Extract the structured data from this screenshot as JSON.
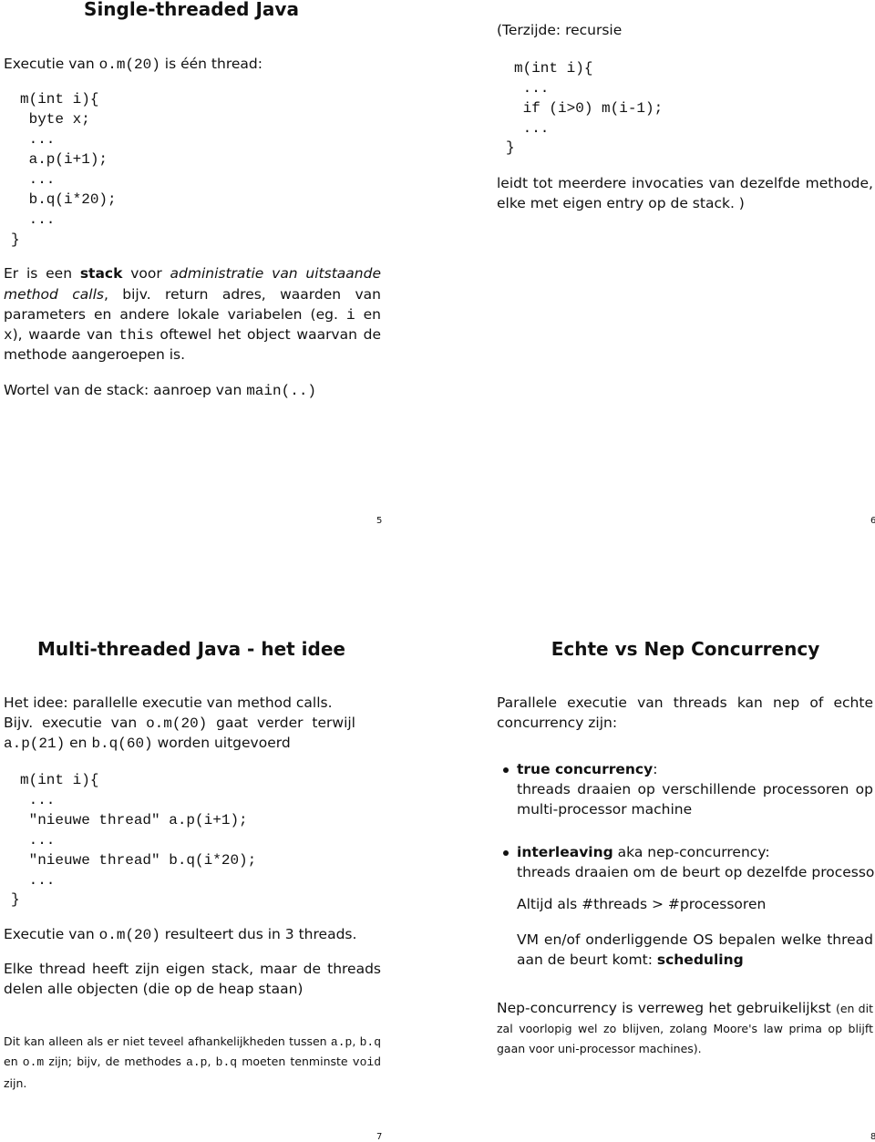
{
  "slides": [
    {
      "title": "Single-threaded Java",
      "page": "5",
      "lines": [
        [
          [
            "r",
            "Executie van "
          ],
          [
            "m",
            "o.m(20)"
          ],
          [
            "r",
            " is één thread:"
          ]
        ],
        [
          [
            "m",
            "m(int i){"
          ]
        ],
        [
          [
            "m",
            " byte x;"
          ]
        ],
        [
          [
            "m",
            " ..."
          ]
        ],
        [
          [
            "m",
            " a.p(i+1);"
          ]
        ],
        [
          [
            "m",
            " ..."
          ]
        ],
        [
          [
            "m",
            " b.q(i*20);"
          ]
        ],
        [
          [
            "m",
            " ..."
          ]
        ],
        [
          [
            "m",
            "}"
          ]
        ],
        [
          [
            "r",
            "Er is een "
          ],
          [
            "b",
            "stack"
          ],
          [
            "r",
            " voor "
          ],
          [
            "i",
            "administratie van uitstaande"
          ]
        ],
        [
          [
            "i",
            "method calls"
          ],
          [
            "r",
            ", bijv. return adres, waarden van"
          ]
        ],
        [
          [
            "r",
            "parameters en andere lokale variabelen (eg. "
          ],
          [
            "m",
            "i"
          ],
          [
            "r",
            " en"
          ]
        ],
        [
          [
            "m",
            "x"
          ],
          [
            "r",
            "), waarde van "
          ],
          [
            "m",
            "this"
          ],
          [
            "r",
            " oftewel het object waarvan de"
          ]
        ],
        [
          [
            "r",
            "methode aangeroepen is."
          ]
        ],
        [
          [
            "r",
            "Wortel van de stack: aanroep van "
          ],
          [
            "m",
            "main(..)"
          ]
        ]
      ]
    },
    {
      "page": "6",
      "lines": [
        [
          [
            "r",
            "(Terzijde: recursie"
          ]
        ],
        [
          [
            "m",
            "m(int i){"
          ]
        ],
        [
          [
            "m",
            " ..."
          ]
        ],
        [
          [
            "m",
            " if (i>0) m(i-1);"
          ]
        ],
        [
          [
            "m",
            " ..."
          ]
        ],
        [
          [
            "m",
            "}"
          ]
        ],
        [
          [
            "r",
            "leidt tot meerdere invocaties van dezelfde methode,"
          ]
        ],
        [
          [
            "r",
            "elke met eigen entry op de stack. )"
          ]
        ]
      ]
    },
    {
      "title": "Multi-threaded Java - het idee",
      "page": "7",
      "lines": [
        [
          [
            "r",
            "Het idee: parallelle executie van method calls."
          ]
        ],
        [
          [
            "r",
            "Bijv. executie van "
          ],
          [
            "m",
            "o.m(20)"
          ],
          [
            "r",
            " gaat verder terwijl"
          ]
        ],
        [
          [
            "m",
            "a.p(21)"
          ],
          [
            "r",
            " en "
          ],
          [
            "m",
            "b.q(60)"
          ],
          [
            "r",
            " worden uitgevoerd"
          ]
        ],
        [
          [
            "m",
            "m(int i){"
          ]
        ],
        [
          [
            "m",
            " ..."
          ]
        ],
        [
          [
            "m",
            " \"nieuwe thread\" a.p(i+1);"
          ]
        ],
        [
          [
            "m",
            " ..."
          ]
        ],
        [
          [
            "m",
            " \"nieuwe thread\" b.q(i*20);"
          ]
        ],
        [
          [
            "m",
            " ..."
          ]
        ],
        [
          [
            "m",
            "}"
          ]
        ],
        [
          [
            "r",
            "Executie van "
          ],
          [
            "m",
            "o.m(20)"
          ],
          [
            "r",
            " resulteert dus in 3 threads."
          ]
        ],
        [
          [
            "r",
            "Elke thread heeft zijn eigen stack, maar de threads"
          ]
        ],
        [
          [
            "r",
            "delen alle objecten (die op de heap staan)"
          ]
        ],
        [
          [
            "s",
            "Dit kan alleen als er niet teveel afhankelijkheden tussen "
          ],
          [
            "ms",
            "a.p"
          ],
          [
            "s",
            ", "
          ],
          [
            "ms",
            "b.q"
          ]
        ],
        [
          [
            "s",
            "en "
          ],
          [
            "ms",
            "o.m"
          ],
          [
            "s",
            " zijn; bijv, de methodes "
          ],
          [
            "ms",
            "a.p"
          ],
          [
            "s",
            ", "
          ],
          [
            "ms",
            "b.q"
          ],
          [
            "s",
            " moeten tenminste "
          ],
          [
            "ms",
            "void"
          ]
        ],
        [
          [
            "s",
            "zijn."
          ]
        ]
      ]
    },
    {
      "title": "Echte vs Nep Concurrency",
      "page": "8",
      "lines": [
        [
          [
            "r",
            "Parallele executie van threads kan nep of echte"
          ]
        ],
        [
          [
            "r",
            "concurrency zijn:"
          ]
        ],
        [
          [
            "b",
            "true concurrency"
          ],
          [
            "r",
            ":"
          ]
        ],
        [
          [
            "r",
            "threads draaien op verschillende processoren op"
          ]
        ],
        [
          [
            "r",
            "multi-processor machine"
          ]
        ],
        [
          [
            "b",
            "interleaving"
          ],
          [
            "r",
            " aka nep-concurrency:"
          ]
        ],
        [
          [
            "r",
            "threads draaien om de beurt op dezelfde processor"
          ]
        ],
        [
          [
            "r",
            "Altijd als #threads > #processoren"
          ]
        ],
        [
          [
            "r",
            "VM en/of onderliggende OS bepalen welke thread"
          ]
        ],
        [
          [
            "r",
            "aan de beurt komt: "
          ],
          [
            "b",
            "scheduling"
          ]
        ],
        [
          [
            "r",
            "Nep-concurrency is verreweg het gebruikelijkst "
          ],
          [
            "s",
            "(en dit"
          ]
        ],
        [
          [
            "s",
            "zal voorlopig wel zo blijven, zolang Moore's law prima op blijft"
          ]
        ],
        [
          [
            "s",
            "gaan voor uni-processor machines)."
          ]
        ]
      ]
    }
  ]
}
